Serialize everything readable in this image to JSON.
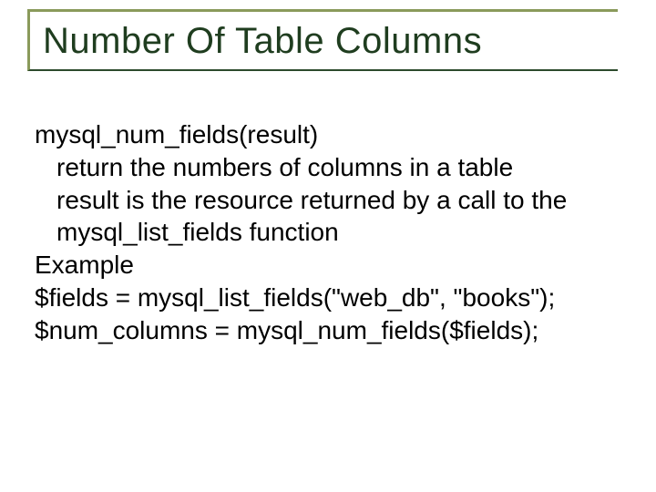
{
  "title": "Number Of Table Columns",
  "body": {
    "l1": "mysql_num_fields(result)",
    "l2": "return the numbers of columns in a table",
    "l3": "result is the resource returned by a call to the",
    "l4": "mysql_list_fields function",
    "l5": "Example",
    "l6": "$fields = mysql_list_fields(\"web_db\", \"books\");",
    "l7": "$num_columns = mysql_num_fields($fields);"
  }
}
